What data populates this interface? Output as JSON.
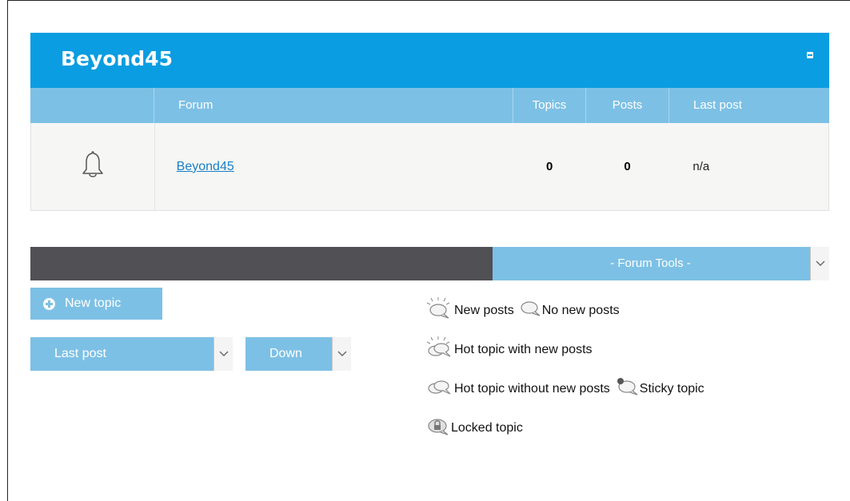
{
  "forum_category": {
    "title": "Beyond45",
    "columns": {
      "forum": "Forum",
      "topics": "Topics",
      "posts": "Posts",
      "last_post": "Last post"
    },
    "rows": [
      {
        "icon": "bell-icon",
        "name": "Beyond45",
        "topics": "0",
        "posts": "0",
        "last_post": "n/a"
      }
    ]
  },
  "toolbar": {
    "forum_tools_label": "- Forum Tools -",
    "new_topic_label": "New topic",
    "sort_by_value": "Last post",
    "sort_order_value": "Down"
  },
  "legend": {
    "new_posts": "New posts",
    "no_new_posts": "No new posts",
    "hot_new": "Hot topic with new posts",
    "hot_no_new": "Hot topic without new posts",
    "sticky": "Sticky topic",
    "locked": "Locked topic"
  },
  "colors": {
    "header_blue": "#0b9de1",
    "light_blue": "#7dc0e5",
    "dark_bar": "#505055"
  }
}
